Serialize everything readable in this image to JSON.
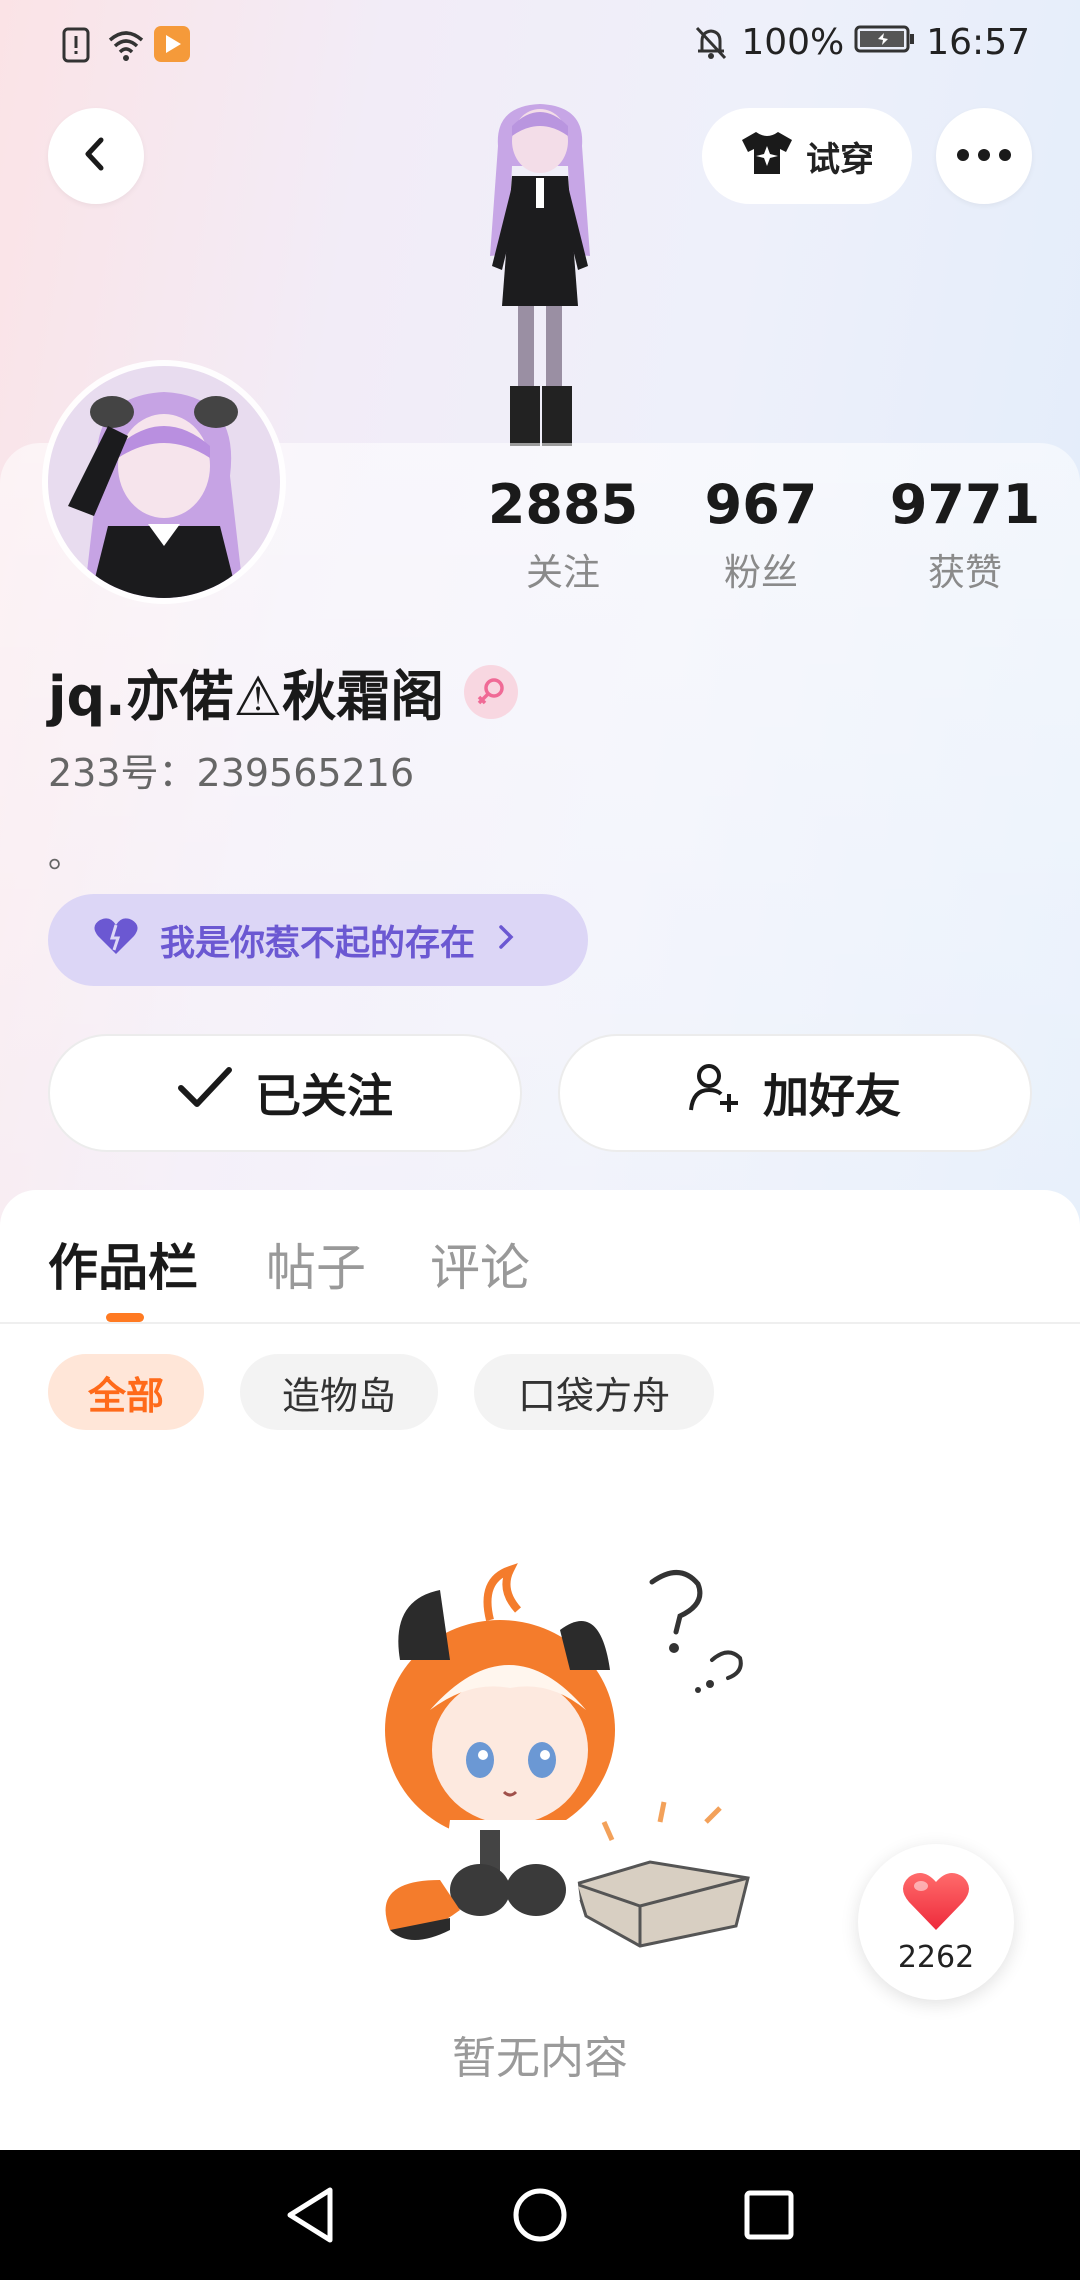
{
  "status_bar": {
    "battery": "100%",
    "time": "16:57",
    "icons": [
      "sim-alert-icon",
      "wifi-icon",
      "app-notify-icon",
      "bell-off-icon",
      "battery-icon"
    ]
  },
  "top_actions": {
    "back_icon": "chevron-left-icon",
    "try_on_label": "试穿",
    "more_icon": "more-dots-icon"
  },
  "stats": [
    {
      "value": "2885",
      "label": "关注"
    },
    {
      "value": "967",
      "label": "粉丝"
    },
    {
      "value": "9771",
      "label": "获赞"
    }
  ],
  "profile": {
    "nickname": "jq.亦偌⚠秋霜阁",
    "gender_icon": "female-icon",
    "uid": "233号：239565216",
    "bio": "。",
    "title_badge": "我是你惹不起的存在"
  },
  "buttons": {
    "followed": "已关注",
    "add_friend": "加好友"
  },
  "tabs": [
    {
      "label": "作品栏",
      "active": true
    },
    {
      "label": "帖子",
      "active": false
    },
    {
      "label": "评论",
      "active": false
    }
  ],
  "filters": [
    {
      "label": "全部",
      "active": true
    },
    {
      "label": "造物岛",
      "active": false
    },
    {
      "label": "口袋方舟",
      "active": false
    }
  ],
  "empty_state": {
    "text": "暂无内容"
  },
  "like_fab": {
    "count": "2262"
  },
  "colors": {
    "accent": "#ff7a22",
    "title_purple": "#6b58d2",
    "heart": "#ff3b4a"
  }
}
